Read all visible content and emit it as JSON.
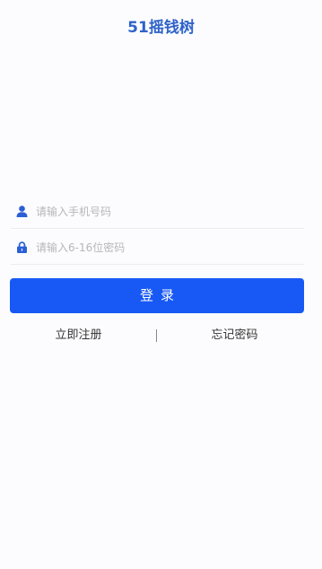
{
  "header": {
    "title": "51摇钱树"
  },
  "form": {
    "phone": {
      "icon": "user-icon",
      "placeholder": "请输入手机号码",
      "value": ""
    },
    "password": {
      "icon": "lock-icon",
      "placeholder": "请输入6-16位密码",
      "value": ""
    },
    "submit_label": "登录"
  },
  "links": {
    "register": "立即注册",
    "forgot_password": "忘记密码"
  },
  "colors": {
    "accent": "#1859f5",
    "title": "#2f63c9",
    "icon": "#2c5fd6"
  }
}
